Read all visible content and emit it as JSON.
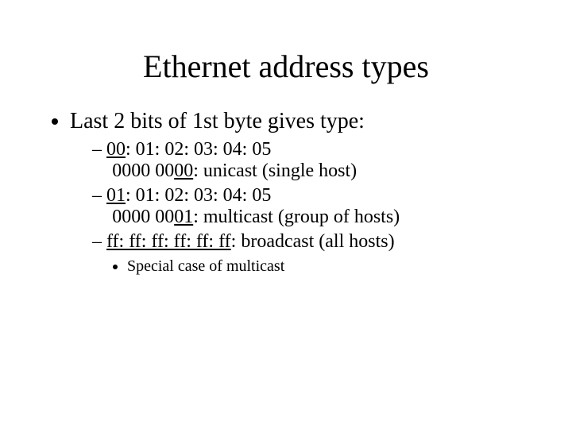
{
  "title": "Ethernet address types",
  "bullet1": "Last 2 bits of 1st byte gives type:",
  "item1": {
    "pre": "00",
    "addr_rest": ": 01: 02: 03: 04: 05",
    "bin_pre": "0000 00",
    "bin_u": "00",
    "desc": ": unicast (single host)"
  },
  "item2": {
    "pre": "01",
    "addr_rest": ": 01: 02: 03: 04: 05",
    "bin_pre": "0000 00",
    "bin_u": "01",
    "desc": ": multicast (group of hosts)"
  },
  "item3": {
    "addr_u": "ff: ff: ff: ff: ff: ff",
    "desc": ": broadcast (all hosts)"
  },
  "sub": "Special case of multicast"
}
